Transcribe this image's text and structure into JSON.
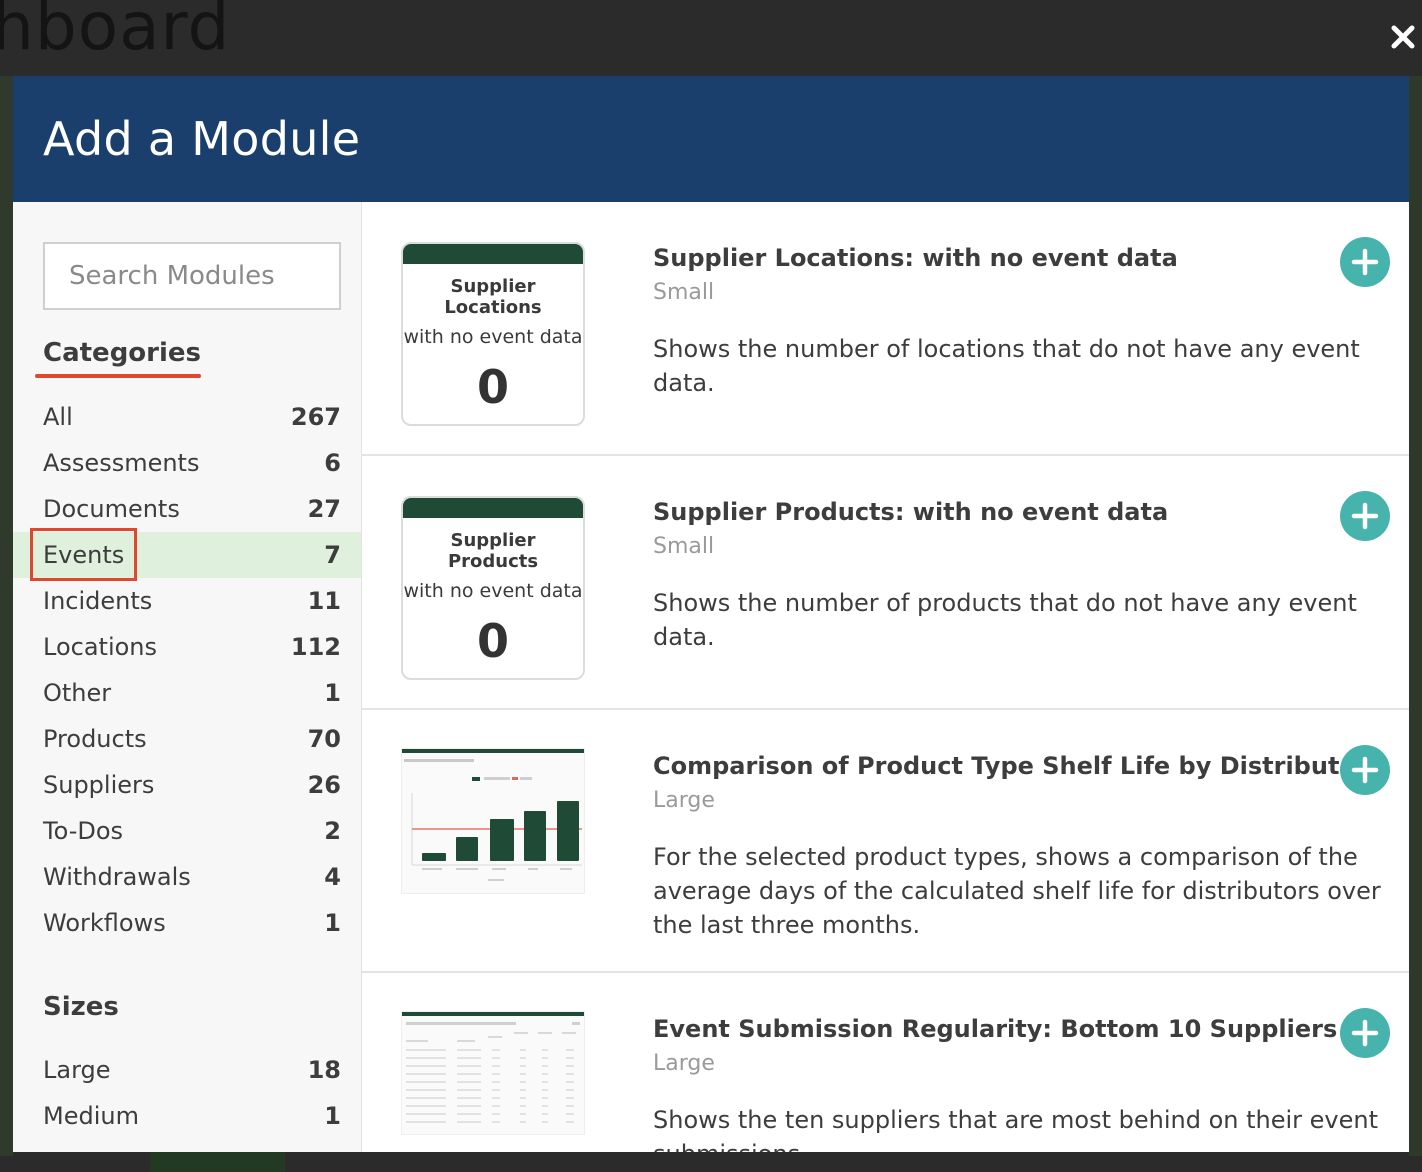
{
  "backdrop": {
    "title_fragment": "hboard"
  },
  "modal": {
    "title": "Add a Module"
  },
  "search": {
    "placeholder": "Search Modules"
  },
  "categories": {
    "heading": "Categories",
    "items": [
      {
        "label": "All",
        "count": "267"
      },
      {
        "label": "Assessments",
        "count": "6"
      },
      {
        "label": "Documents",
        "count": "27"
      },
      {
        "label": "Events",
        "count": "7",
        "active": true
      },
      {
        "label": "Incidents",
        "count": "11"
      },
      {
        "label": "Locations",
        "count": "112"
      },
      {
        "label": "Other",
        "count": "1"
      },
      {
        "label": "Products",
        "count": "70"
      },
      {
        "label": "Suppliers",
        "count": "26"
      },
      {
        "label": "To-Dos",
        "count": "2"
      },
      {
        "label": "Withdrawals",
        "count": "4"
      },
      {
        "label": "Workflows",
        "count": "1"
      }
    ]
  },
  "sizes": {
    "heading": "Sizes",
    "items": [
      {
        "label": "Large",
        "count": "18"
      },
      {
        "label": "Medium",
        "count": "1"
      }
    ]
  },
  "modules": [
    {
      "title": "Supplier Locations: with no event data",
      "size": "Small",
      "description": "Shows the number of locations that do not have any event data.",
      "thumb": {
        "line1": "Supplier Locations",
        "line2": "with no event data",
        "value": "0"
      }
    },
    {
      "title": "Supplier Products: with no event data",
      "size": "Small",
      "description": "Shows the number of products that do not have any event data.",
      "thumb": {
        "line1": "Supplier Products",
        "line2": "with no event data",
        "value": "0"
      }
    },
    {
      "title": "Comparison of Product Type Shelf Life by Distributor",
      "size": "Large",
      "description": "For the selected product types, shows a comparison of the average days of the calculated shelf life for distributors over the last three months."
    },
    {
      "title": "Event Submission Regularity: Bottom 10 Suppliers",
      "size": "Large",
      "description": "Shows the ten suppliers that are most behind on their event submissions."
    }
  ],
  "colors": {
    "header": "#1b3f6d",
    "accent": "#46b3ac",
    "highlight": "#e0472f",
    "active_bg": "#dff0dc",
    "thumb_green": "#1f4a35"
  },
  "icons": {
    "close": "close-icon",
    "add": "plus-circle-icon"
  }
}
